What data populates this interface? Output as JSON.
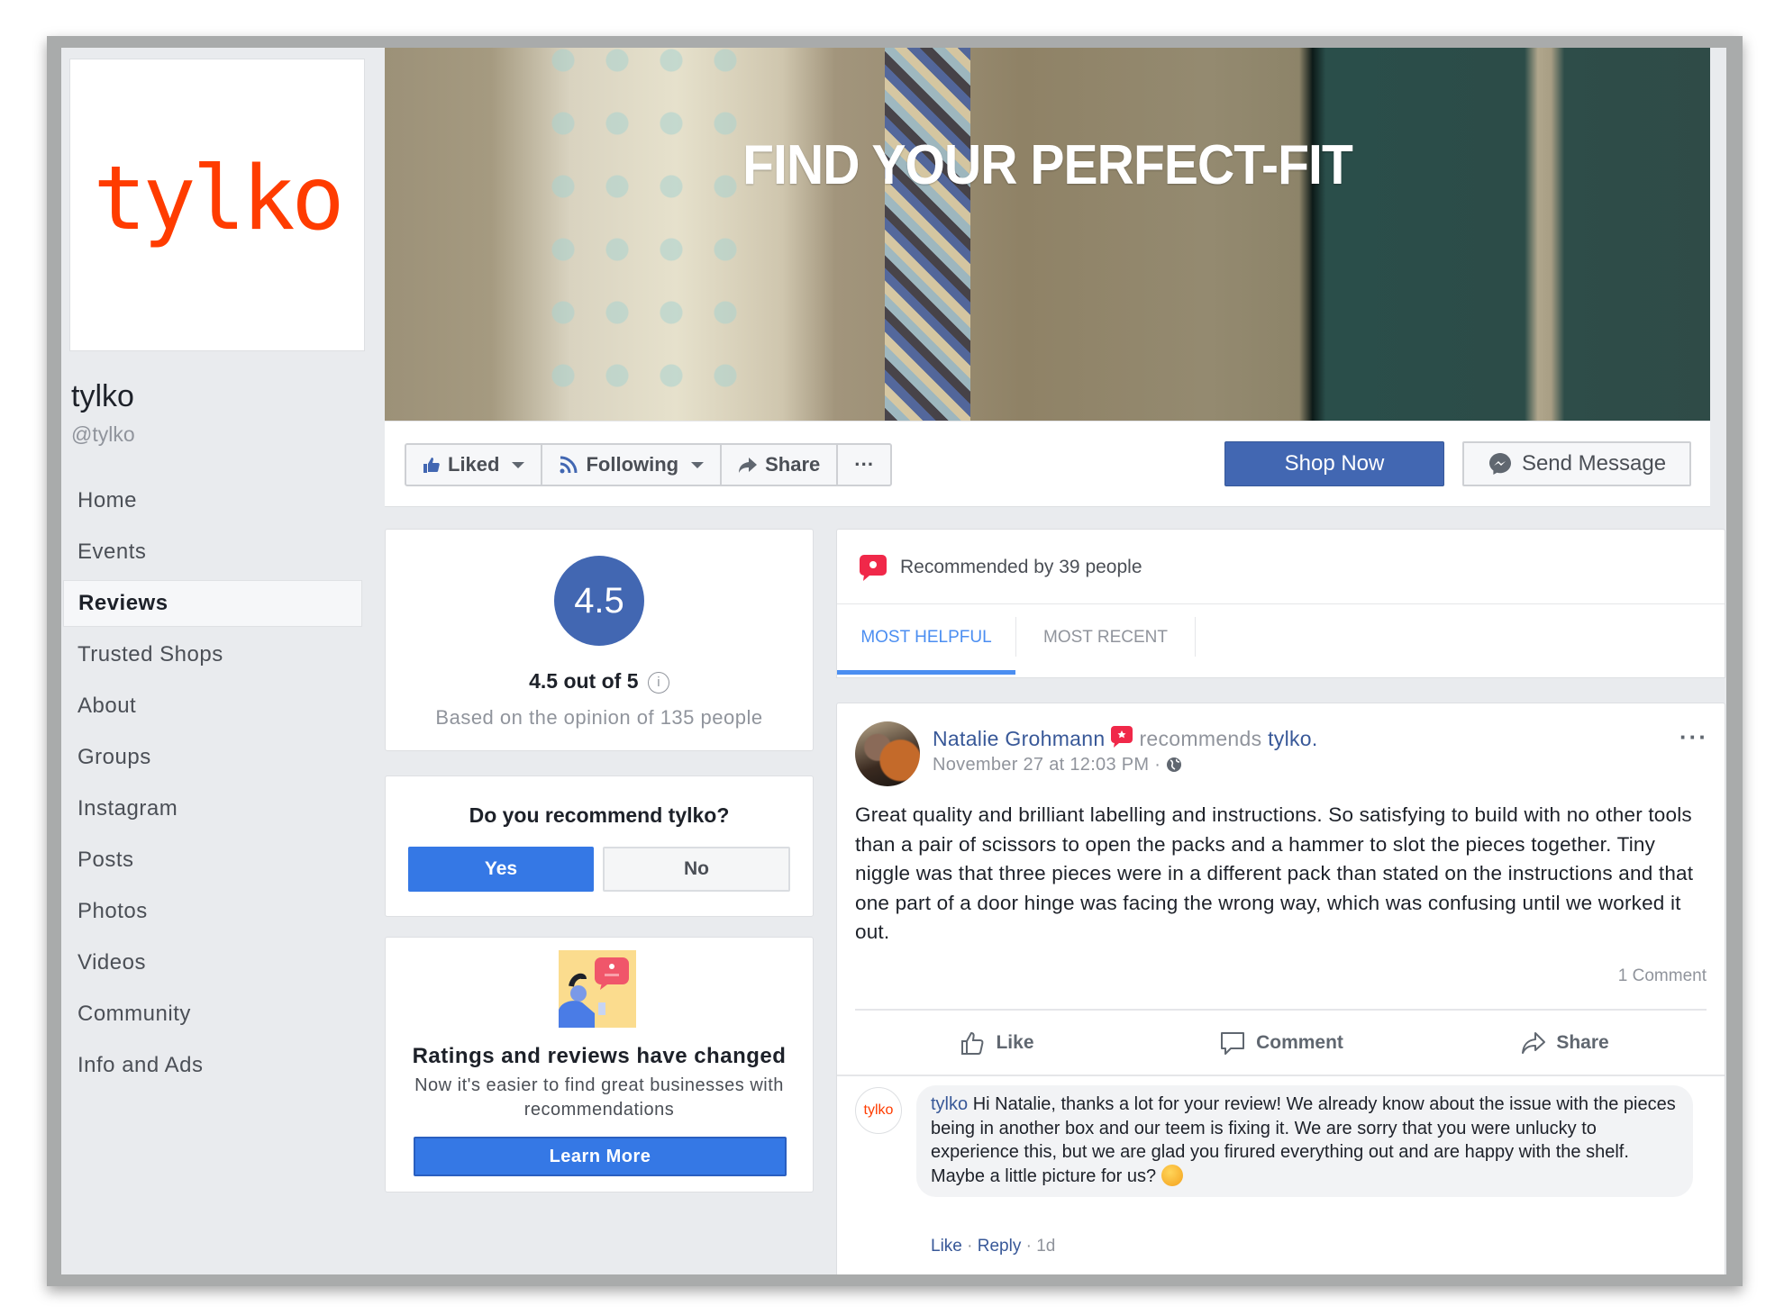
{
  "page": {
    "logo_text": "tylko",
    "name": "tylko",
    "handle": "@tylko",
    "brand_color": "#ff3c00"
  },
  "sidebar": {
    "items": [
      {
        "label": "Home",
        "active": false
      },
      {
        "label": "Events",
        "active": false
      },
      {
        "label": "Reviews",
        "active": true
      },
      {
        "label": "Trusted Shops",
        "active": false
      },
      {
        "label": "About",
        "active": false
      },
      {
        "label": "Groups",
        "active": false
      },
      {
        "label": "Instagram",
        "active": false
      },
      {
        "label": "Posts",
        "active": false
      },
      {
        "label": "Photos",
        "active": false
      },
      {
        "label": "Videos",
        "active": false
      },
      {
        "label": "Community",
        "active": false
      },
      {
        "label": "Info and Ads",
        "active": false
      }
    ]
  },
  "cover": {
    "title": "FIND YOUR PERFECT-FIT"
  },
  "actions": {
    "liked": "Liked",
    "following": "Following",
    "share": "Share",
    "more": "···",
    "shop_now": "Shop Now",
    "send_message": "Send Message",
    "accent": "#4267b2"
  },
  "rating": {
    "score": "4.5",
    "summary": "4.5 out of 5",
    "info_icon": "i",
    "basis": "Based on the opinion of 135 people"
  },
  "recommend": {
    "question": "Do you recommend tylko?",
    "yes": "Yes",
    "no": "No"
  },
  "changed": {
    "title": "Ratings and reviews have changed",
    "subtitle": "Now it's easier to find great businesses with recommendations",
    "button": "Learn More"
  },
  "reviews": {
    "recommended_by": "Recommended by 39 people",
    "tabs": [
      {
        "label": "MOST HELPFUL",
        "active": true
      },
      {
        "label": "MOST RECENT",
        "active": false
      }
    ]
  },
  "post": {
    "author": "Natalie Grohmann",
    "verb": "recommends",
    "target": "tylko.",
    "time": "November 27 at 12:03 PM",
    "separator": "·",
    "more": "···",
    "body": "Great quality and brilliant labelling and instructions. So satisfying to build with no other tools than a pair of scissors to open the packs and a hammer to slot the pieces together. Tiny niggle was that three pieces were in a different pack than stated on the instructions and that one part of a door hinge was facing the wrong way, which was confusing until we worked it out.",
    "comment_count": "1 Comment",
    "actions": {
      "like": "Like",
      "comment": "Comment",
      "share": "Share"
    }
  },
  "comment": {
    "avatar_text": "tylko",
    "author": "tylko",
    "text": "Hi Natalie, thanks a lot for your review! We already know about the issue with the pieces being in another box and our teem is fixing it. We are sorry that you were unlucky to experience this, but we are glad you firured everything out and are happy with the shelf. Maybe a little picture for us?",
    "like": "Like",
    "reply": "Reply",
    "age": "1d",
    "dot": "·"
  }
}
